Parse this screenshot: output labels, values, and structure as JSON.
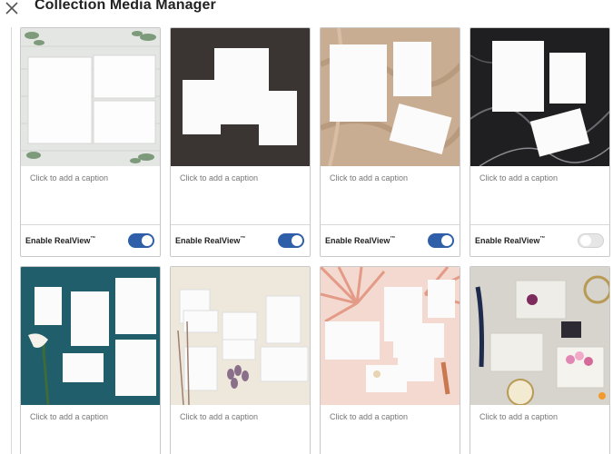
{
  "header": {
    "title": "Collection Media Manager",
    "close_icon": "close-icon"
  },
  "cards": [
    {
      "caption_placeholder": "Click to add a caption",
      "realview_label": "Enable RealView",
      "realview_mark": "™",
      "realview_on": true,
      "scene": "white wood with eucalyptus"
    },
    {
      "caption_placeholder": "Click to add a caption",
      "realview_label": "Enable RealView",
      "realview_mark": "™",
      "realview_on": true,
      "scene": "dark brown"
    },
    {
      "caption_placeholder": "Click to add a caption",
      "realview_label": "Enable RealView",
      "realview_mark": "™",
      "realview_on": true,
      "scene": "tan fabric"
    },
    {
      "caption_placeholder": "Click to add a caption",
      "realview_label": "Enable RealView",
      "realview_mark": "™",
      "realview_on": false,
      "scene": "black marble"
    },
    {
      "caption_placeholder": "Click to add a caption",
      "scene": "teal with calla lily"
    },
    {
      "caption_placeholder": "Click to add a caption",
      "scene": "cream with dried flowers"
    },
    {
      "caption_placeholder": "Click to add a caption",
      "scene": "pink palm leaves"
    },
    {
      "caption_placeholder": "Click to add a caption",
      "scene": "grey desk with feather quill"
    }
  ],
  "colors": {
    "toggle_on": "#2f5fa8",
    "toggle_off": "#e6e6e6"
  }
}
